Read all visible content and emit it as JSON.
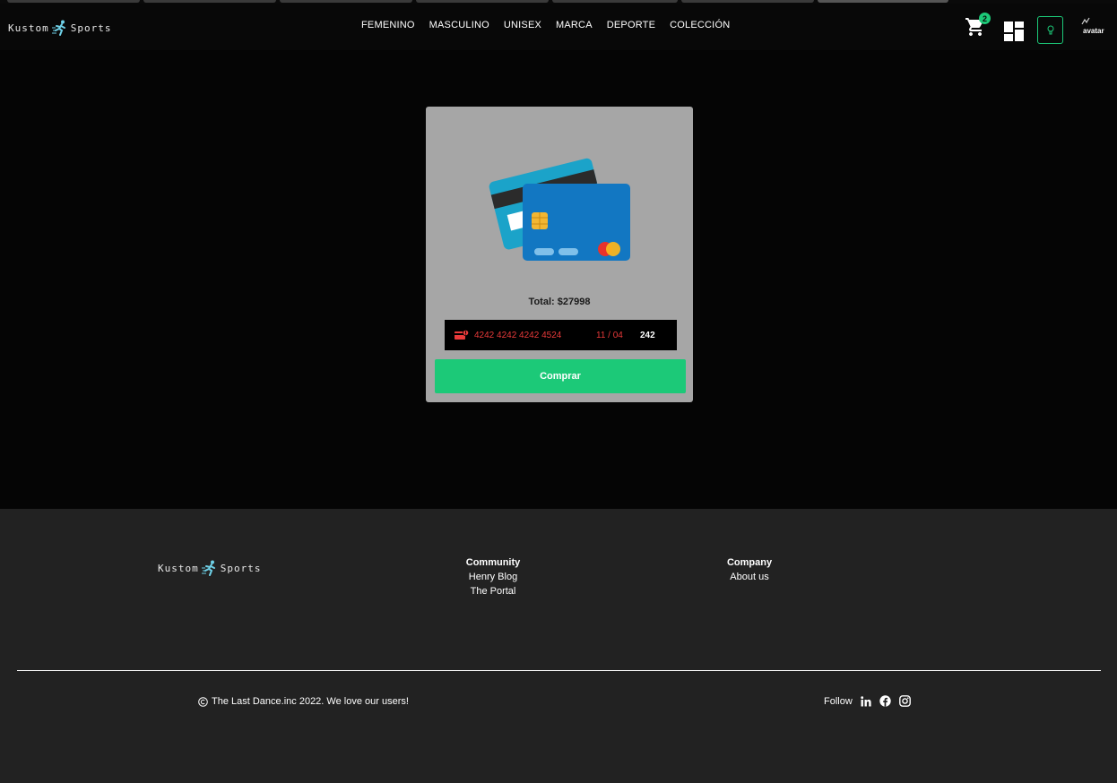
{
  "brand": {
    "name_left": "Kustom",
    "name_right": "Sports"
  },
  "nav": {
    "links": [
      "FEMENINO",
      "MASCULINO",
      "UNISEX",
      "MARCA",
      "DEPORTE",
      "COLECCIÓN"
    ]
  },
  "header": {
    "cart_count": "2",
    "avatar_alt": "avatar",
    "icons": [
      "cart-icon",
      "dashboard-icon",
      "lightbulb-icon",
      "avatar-image"
    ]
  },
  "payment": {
    "total_label": "Total: $27998",
    "card_number": "4242 4242 4242 4524",
    "expiry": "11 / 04",
    "cvc": "242",
    "buy_label": "Comprar"
  },
  "footer": {
    "community_title": "Community",
    "community_links": [
      "Henry Blog",
      "The Portal"
    ],
    "company_title": "Company",
    "company_links": [
      "About us"
    ],
    "copyright": "The Last Dance.inc 2022. We love our users!",
    "follow_label": "Follow",
    "social_icons": [
      "linkedin-icon",
      "facebook-icon",
      "instagram-icon"
    ]
  },
  "colors": {
    "accent": "#1cc978",
    "card_bg": "#a6a6a6",
    "error_red": "#e83a3a",
    "footer_bg": "#222222"
  }
}
